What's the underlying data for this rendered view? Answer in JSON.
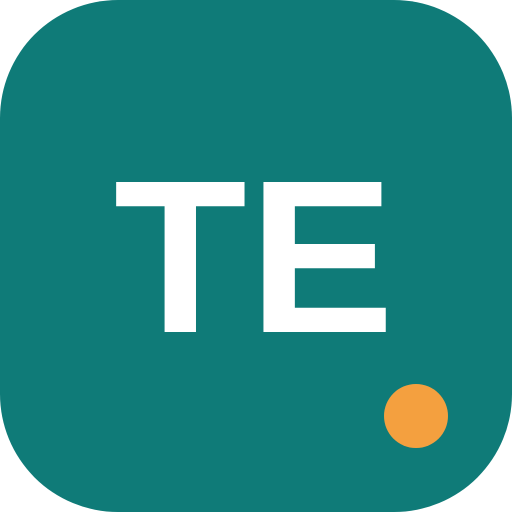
{
  "icon": {
    "label": "TE",
    "background_color": "#0f7b78",
    "label_color": "#ffffff",
    "badge": {
      "shape": "dot",
      "color": "#f4a03f"
    }
  }
}
